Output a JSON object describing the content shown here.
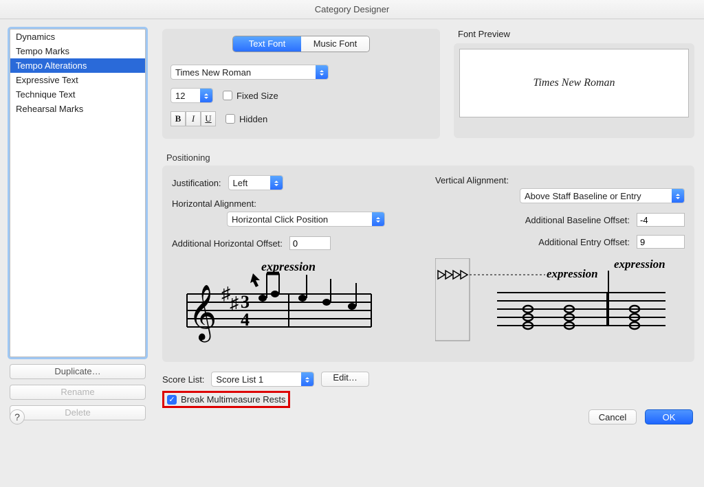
{
  "window": {
    "title": "Category Designer"
  },
  "sidebar": {
    "items": [
      {
        "label": "Dynamics"
      },
      {
        "label": "Tempo Marks"
      },
      {
        "label": "Tempo Alterations",
        "selected": true
      },
      {
        "label": "Expressive Text"
      },
      {
        "label": "Technique Text"
      },
      {
        "label": "Rehearsal Marks"
      }
    ],
    "duplicate": "Duplicate…",
    "rename": "Rename",
    "delete": "Delete"
  },
  "tabs": {
    "text_font": "Text Font",
    "music_font": "Music Font"
  },
  "font": {
    "family": "Times New Roman",
    "size": "12",
    "fixed_size_label": "Fixed Size",
    "hidden_label": "Hidden",
    "bold": "B",
    "italic": "I",
    "underline": "U"
  },
  "preview": {
    "header": "Font Preview",
    "sample": "Times New Roman"
  },
  "positioning": {
    "header": "Positioning",
    "justification_label": "Justification:",
    "justification_value": "Left",
    "h_align_label": "Horizontal Alignment:",
    "h_align_value": "Horizontal Click Position",
    "h_offset_label": "Additional Horizontal Offset:",
    "h_offset_value": "0",
    "v_align_label": "Vertical Alignment:",
    "v_align_value": "Above Staff Baseline or Entry",
    "baseline_offset_label": "Additional Baseline Offset:",
    "baseline_offset_value": "-4",
    "entry_offset_label": "Additional Entry Offset:",
    "entry_offset_value": "9",
    "diagram_text": "expression"
  },
  "score": {
    "label": "Score List:",
    "value": "Score List 1",
    "edit": "Edit…",
    "break_rests_label": "Break Multimeasure Rests",
    "break_rests_checked": true
  },
  "buttons": {
    "cancel": "Cancel",
    "ok": "OK",
    "help": "?"
  }
}
